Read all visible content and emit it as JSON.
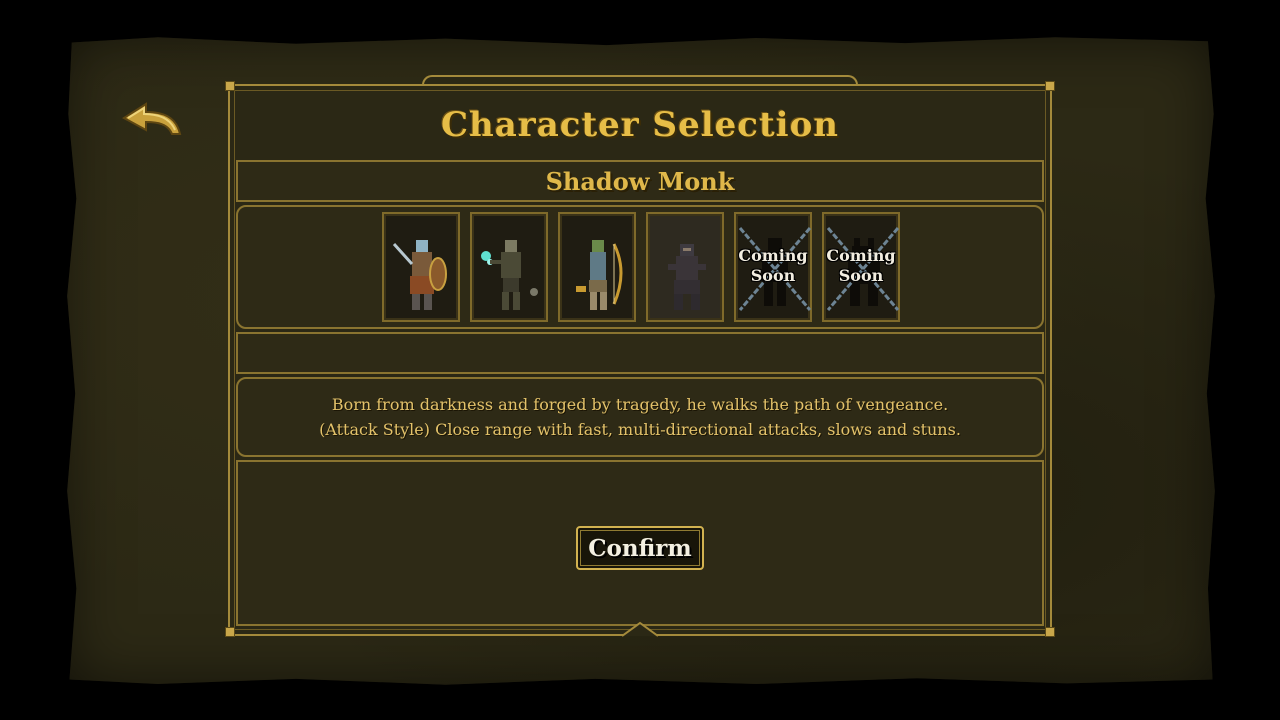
{
  "screen": {
    "title": "Character Selection",
    "selected_character_name": "Shadow Monk"
  },
  "characters": [
    {
      "id": "knight",
      "icon": "knight-with-shield-icon",
      "locked": false
    },
    {
      "id": "undead-mage",
      "icon": "undead-mage-icon",
      "locked": false
    },
    {
      "id": "archer",
      "icon": "archer-with-bow-icon",
      "locked": false
    },
    {
      "id": "shadow-monk",
      "icon": "hooded-monk-icon",
      "locked": false,
      "selected": true
    },
    {
      "id": "locked-1",
      "icon": "locked-silhouette-icon",
      "locked": true,
      "label": "Coming\nSoon"
    },
    {
      "id": "locked-2",
      "icon": "locked-silhouette-icon",
      "locked": true,
      "label": "Coming\nSoon"
    }
  ],
  "description": {
    "line1": "Born from darkness and forged by tragedy, he walks the path of vengeance.",
    "line2": "(Attack Style) Close range with fast, multi-directional attacks, slows and stuns."
  },
  "buttons": {
    "confirm_label": "Confirm",
    "back_icon": "back-arrow-icon"
  },
  "colors": {
    "gold_text": "#e6bd47",
    "frame_gold": "#a48a3b",
    "panel_bg": "#2b2815",
    "description_text": "#e3c26a"
  }
}
